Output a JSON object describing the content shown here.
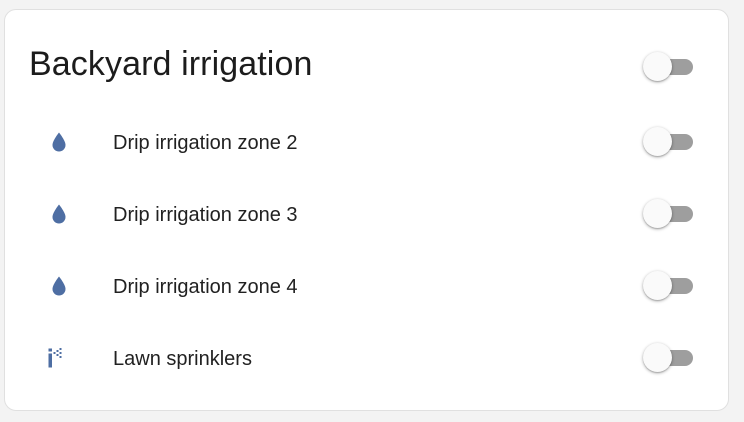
{
  "card": {
    "title": "Backyard irrigation",
    "master_toggle": {
      "state": "off"
    }
  },
  "entities": [
    {
      "name": "Drip irrigation zone 2",
      "icon": "water-drop-icon",
      "state": "off"
    },
    {
      "name": "Drip irrigation zone 3",
      "icon": "water-drop-icon",
      "state": "off"
    },
    {
      "name": "Drip irrigation zone 4",
      "icon": "water-drop-icon",
      "state": "off"
    },
    {
      "name": "Lawn sprinklers",
      "icon": "sprinkler-icon",
      "state": "off"
    }
  ],
  "colors": {
    "icon": "#4e6ea3",
    "toggle_track_off": "#9e9e9e",
    "toggle_thumb_off": "#fafafa"
  }
}
